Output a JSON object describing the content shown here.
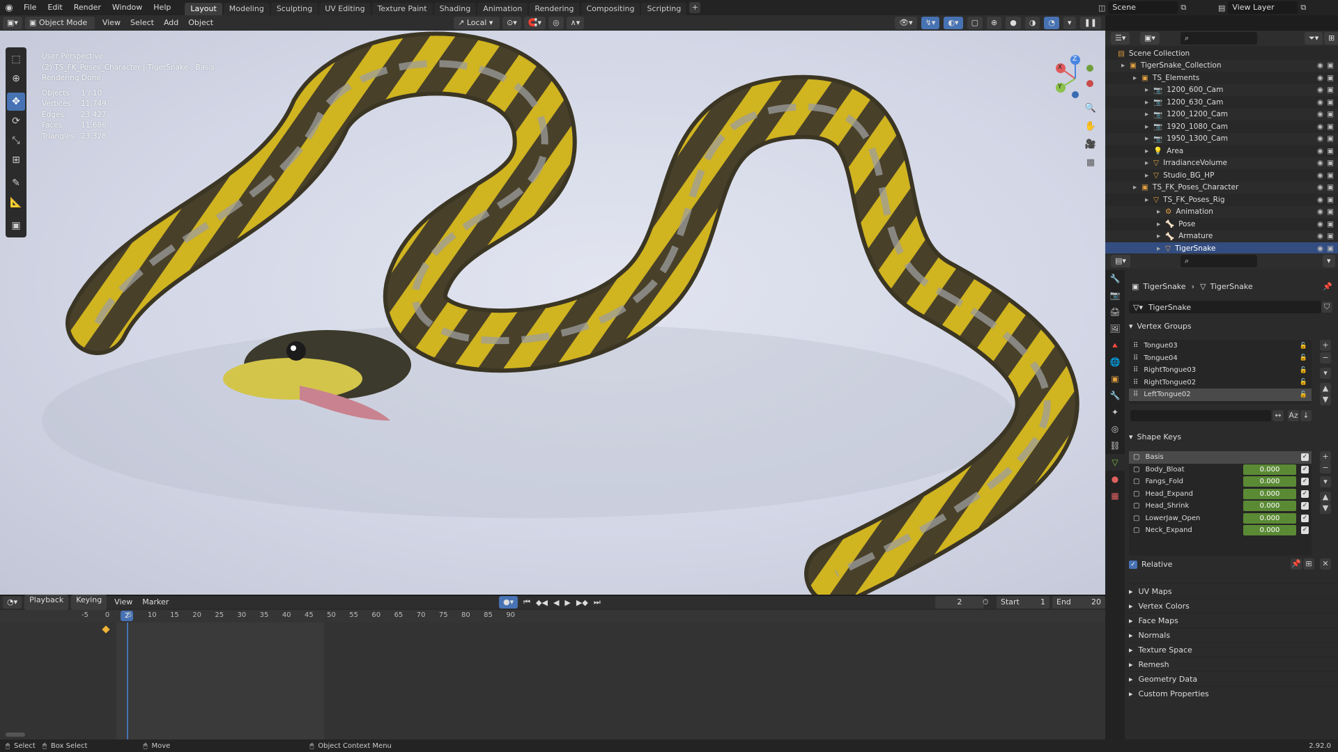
{
  "topbar": {
    "menus": [
      "File",
      "Edit",
      "Render",
      "Window",
      "Help"
    ],
    "workspaces": [
      "Layout",
      "Modeling",
      "Sculpting",
      "UV Editing",
      "Texture Paint",
      "Shading",
      "Animation",
      "Rendering",
      "Compositing",
      "Scripting"
    ],
    "active_workspace": "Layout",
    "scene": "Scene",
    "view_layer": "View Layer"
  },
  "viewport_header": {
    "mode": "Object Mode",
    "menus": [
      "View",
      "Select",
      "Add",
      "Object"
    ],
    "orientation": "Local"
  },
  "overlay": {
    "title": "User Perspective",
    "subtitle": "(2) TS_FK_Poses_Character | TigerSnake : Basis",
    "status": "Rendering Done",
    "stats": [
      {
        "label": "Objects",
        "value": "1 / 10"
      },
      {
        "label": "Vertices",
        "value": "11,749"
      },
      {
        "label": "Edges",
        "value": "23,427"
      },
      {
        "label": "Faces",
        "value": "11,686"
      },
      {
        "label": "Triangles",
        "value": "23,328"
      }
    ]
  },
  "gizmo": {
    "x": "X",
    "y": "Y",
    "z": "Z"
  },
  "timeline": {
    "menus": [
      "Playback",
      "Keying",
      "View",
      "Marker"
    ],
    "current_frame": "2",
    "start_label": "Start",
    "start": "1",
    "end_label": "End",
    "end": "20",
    "ruler": [
      "-5",
      "0",
      "2",
      "5",
      "10",
      "15",
      "20",
      "25",
      "30",
      "35",
      "40",
      "45",
      "50",
      "55",
      "60",
      "65",
      "70",
      "75",
      "80",
      "85",
      "90"
    ]
  },
  "statusbar": {
    "select": "Select",
    "box_select": "Box Select",
    "move": "Move",
    "context_menu": "Object Context Menu",
    "version": "2.92.0"
  },
  "outliner": {
    "rows": [
      {
        "label": "Scene Collection",
        "indent": 0
      },
      {
        "label": "TigerSnake_Collection",
        "indent": 1
      },
      {
        "label": "TS_Elements",
        "indent": 2
      },
      {
        "label": "1200_600_Cam",
        "indent": 3
      },
      {
        "label": "1200_630_Cam",
        "indent": 3
      },
      {
        "label": "1200_1200_Cam",
        "indent": 3
      },
      {
        "label": "1920_1080_Cam",
        "indent": 3
      },
      {
        "label": "1950_1300_Cam",
        "indent": 3
      },
      {
        "label": "Area",
        "indent": 3
      },
      {
        "label": "IrradianceVolume",
        "indent": 3
      },
      {
        "label": "Studio_BG_HP",
        "indent": 3
      },
      {
        "label": "TS_FK_Poses_Character",
        "indent": 2
      },
      {
        "label": "TS_FK_Poses_Rig",
        "indent": 3
      },
      {
        "label": "Animation",
        "indent": 4
      },
      {
        "label": "Pose",
        "indent": 4
      },
      {
        "label": "Armature",
        "indent": 4
      },
      {
        "label": "TigerSnake",
        "indent": 4
      }
    ]
  },
  "properties": {
    "breadcrumb_object": "TigerSnake",
    "breadcrumb_data": "TigerSnake",
    "data_name": "TigerSnake",
    "vertex_groups_title": "Vertex Groups",
    "vertex_groups": [
      "Tongue03",
      "Tongue04",
      "RightTongue03",
      "RightTongue02",
      "LeftTongue02"
    ],
    "shape_keys_title": "Shape Keys",
    "shape_keys": [
      {
        "name": "Basis",
        "value": ""
      },
      {
        "name": "Body_Bloat",
        "value": "0.000"
      },
      {
        "name": "Fangs_Fold",
        "value": "0.000"
      },
      {
        "name": "Head_Expand",
        "value": "0.000"
      },
      {
        "name": "Head_Shrink",
        "value": "0.000"
      },
      {
        "name": "LowerJaw_Open",
        "value": "0.000"
      },
      {
        "name": "Neck_Expand",
        "value": "0.000"
      }
    ],
    "relative_label": "Relative",
    "collapsed_panels": [
      "UV Maps",
      "Vertex Colors",
      "Face Maps",
      "Normals",
      "Texture Space",
      "Remesh",
      "Geometry Data",
      "Custom Properties"
    ]
  }
}
